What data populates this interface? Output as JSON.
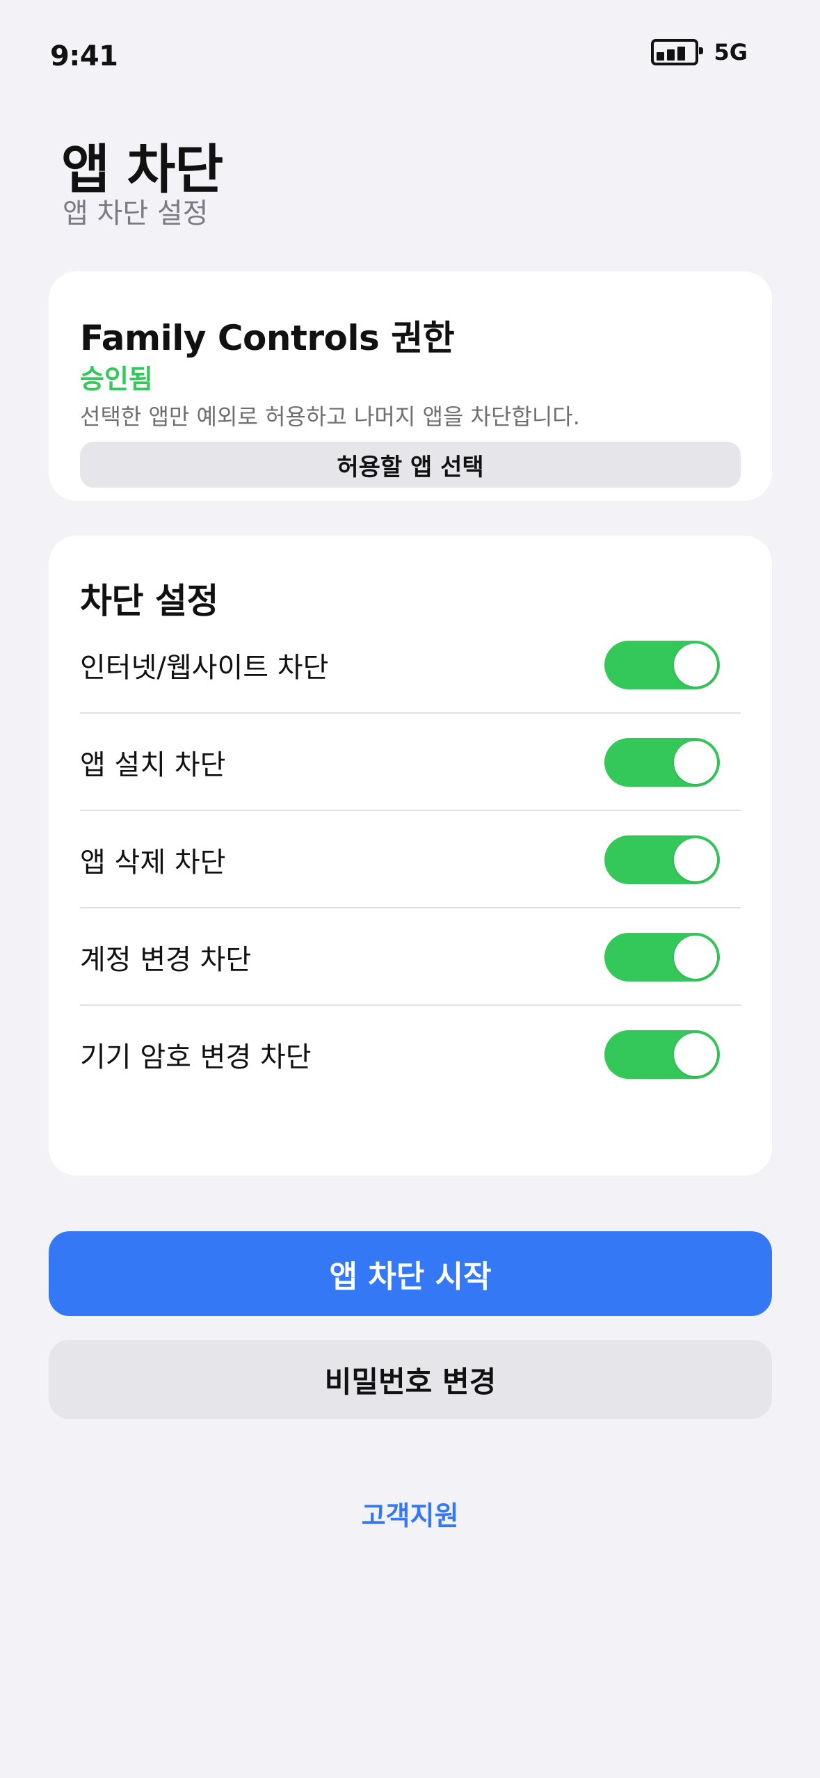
{
  "status_bar": {
    "time": "9:41",
    "network": "5G",
    "battery_icon": "battery-icon"
  },
  "header": {
    "title": "앱 차단",
    "subtitle": "앱 차단 설정"
  },
  "permission_card": {
    "title": "Family Controls 권한",
    "status": "승인됨",
    "description": "선택한 앱만 예외로 허용하고 나머지 앱을 차단합니다.",
    "select_button_label": "허용할 앱 선택"
  },
  "settings_card": {
    "title": "차단 설정",
    "items": [
      {
        "label": "인터넷/웹사이트 차단",
        "enabled": true
      },
      {
        "label": "앱 설치 차단",
        "enabled": true
      },
      {
        "label": "앱 삭제 차단",
        "enabled": true
      },
      {
        "label": "계정 변경 차단",
        "enabled": true
      },
      {
        "label": "기기 암호 변경 차단",
        "enabled": true
      }
    ]
  },
  "actions": {
    "start_label": "앱 차단 시작",
    "change_password_label": "비밀번호 변경",
    "support_label": "고객지원"
  },
  "colors": {
    "accent": "#3478f6",
    "toggle_on": "#34c759",
    "status_approved": "#34c759",
    "background": "#f2f2f7"
  }
}
